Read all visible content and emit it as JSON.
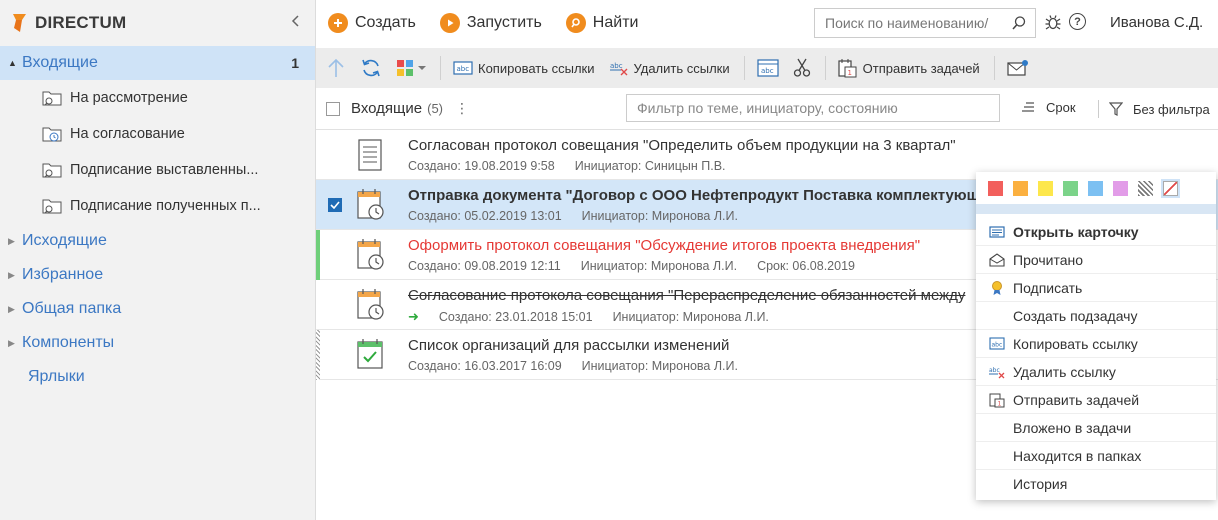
{
  "app": {
    "logo_text": "DIRECTUM"
  },
  "sidebar": {
    "inbox": {
      "label": "Входящие",
      "count": "1"
    },
    "sub_items": [
      {
        "label": "На рассмотрение"
      },
      {
        "label": "На согласование"
      },
      {
        "label": "Подписание выставленны..."
      },
      {
        "label": "Подписание полученных п..."
      }
    ],
    "items": [
      {
        "label": "Исходящие"
      },
      {
        "label": "Избранное"
      },
      {
        "label": "Общая папка"
      },
      {
        "label": "Компоненты"
      }
    ],
    "labels_item": "Ярлыки"
  },
  "topbar": {
    "create_label": "Создать",
    "run_label": "Запустить",
    "find_label": "Найти",
    "search_placeholder": "Поиск по наименованию/",
    "user_name": "Иванова С.Д."
  },
  "actionbar": {
    "copy_links_label": "Копировать ссылки",
    "delete_links_label": "Удалить ссылки",
    "send_task_label": "Отправить задачей"
  },
  "list": {
    "title": "Входящие",
    "count": "(5)",
    "filter_placeholder": "Фильтр по теме, инициатору, состоянию",
    "sort_label": "Срок",
    "filter_label": "Без фильтра",
    "rows": [
      {
        "title": "Согласован протокол совещания \"Определить объем продукции на 3 квартал\"",
        "created": "Создано: 19.08.2019 9:58",
        "initiator": "Инициатор: Синицын П.В.",
        "deadline": ""
      },
      {
        "title": "Отправка документа \"Договор с ООО Нефтепродукт Поставка комплектующих\"",
        "created": "Создано: 05.02.2019 13:01",
        "initiator": "Инициатор: Миронова Л.И.",
        "deadline": ""
      },
      {
        "title": "Оформить протокол совещания \"Обсуждение итогов проекта внедрения\"",
        "created": "Создано: 09.08.2019 12:11",
        "initiator": "Инициатор: Миронова Л.И.",
        "deadline": "Срок: 06.08.2019"
      },
      {
        "title": "Согласование протокола совещания \"Перераспределение обязанностей между",
        "created": "Создано: 23.01.2018 15:01",
        "initiator": "Инициатор: Миронова Л.И.",
        "deadline": ""
      },
      {
        "title": "Список организаций для рассылки изменений",
        "created": "Создано: 16.03.2017 16:09",
        "initiator": "Инициатор: Миронова Л.И.",
        "deadline": ""
      }
    ]
  },
  "context_menu": {
    "colors": [
      "#f25f5c",
      "#fbb040",
      "#fde74c",
      "#7bd389",
      "#7cc0f2",
      "#e29ce8"
    ],
    "items": [
      {
        "label": "Открыть карточку",
        "icon": "card-icon"
      },
      {
        "label": "Прочитано",
        "icon": "envelope-open-icon"
      },
      {
        "label": "Подписать",
        "icon": "medal-icon"
      },
      {
        "label": "Создать подзадачу",
        "icon": ""
      },
      {
        "label": "Копировать ссылку",
        "icon": "copy-link-icon"
      },
      {
        "label": "Удалить ссылку",
        "icon": "delete-link-icon"
      },
      {
        "label": "Отправить задачей",
        "icon": "send-task-icon"
      },
      {
        "label": "Вложено в задачи",
        "icon": ""
      },
      {
        "label": "Находится в папках",
        "icon": ""
      },
      {
        "label": "История",
        "icon": ""
      }
    ]
  },
  "theme": {
    "accent": "#f08c1e",
    "link": "#3c78c3",
    "selected": "#d3e6f8"
  }
}
